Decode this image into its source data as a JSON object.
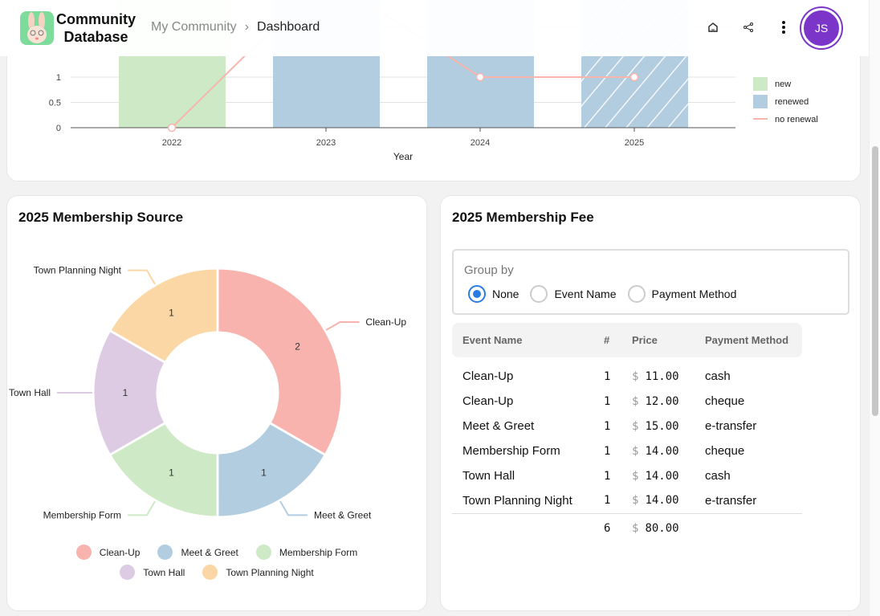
{
  "header": {
    "brand_line1": "Community",
    "brand_line2": "Database",
    "breadcrumb": [
      "My Community",
      "Dashboard"
    ],
    "avatar_initials": "JS",
    "icons": [
      "home-icon",
      "share-icon",
      "more-vertical-icon"
    ]
  },
  "membership_chart": {
    "chart_data": {
      "type": "bar",
      "categories": [
        "2022",
        "2023",
        "2024",
        "2025"
      ],
      "xlabel": "Year",
      "ylabel": "",
      "y_ticks": [
        "0",
        "0.5",
        "1"
      ],
      "series": [
        {
          "name": "new",
          "type": "bar",
          "values": [
            3,
            0,
            0,
            0
          ],
          "color": "#cde9c6"
        },
        {
          "name": "renewed",
          "type": "bar",
          "values": [
            0,
            3,
            3,
            3
          ],
          "color": "#b3cde0",
          "hatched_categories": [
            "2025"
          ]
        },
        {
          "name": "no renewal",
          "type": "line",
          "values": [
            0,
            3,
            1,
            1
          ],
          "color": "#f7b5ad"
        }
      ],
      "legend": "right",
      "grid": true
    }
  },
  "source_card": {
    "title": "2025 Membership Source",
    "chart_data": {
      "type": "pie",
      "donut": true,
      "slices": [
        {
          "label": "Clean-Up",
          "value": 2,
          "color": "#f8b3ae"
        },
        {
          "label": "Meet & Greet",
          "value": 1,
          "color": "#b3cde0"
        },
        {
          "label": "Membership Form",
          "value": 1,
          "color": "#cde9c6"
        },
        {
          "label": "Town Hall",
          "value": 1,
          "color": "#dccbe3"
        },
        {
          "label": "Town Planning Night",
          "value": 1,
          "color": "#fbd7a6"
        }
      ],
      "legend": "bottom"
    }
  },
  "fee_card": {
    "title": "2025 Membership Fee",
    "group_by_label": "Group by",
    "options": [
      {
        "label": "None",
        "selected": true
      },
      {
        "label": "Event Name",
        "selected": false
      },
      {
        "label": "Payment Method",
        "selected": false
      }
    ],
    "columns": [
      "Event Name",
      "#",
      "Price",
      "Payment Method"
    ],
    "rows": [
      {
        "event": "Clean-Up",
        "count": "1",
        "currency": "$",
        "price": "11.00",
        "method": "cash"
      },
      {
        "event": "Clean-Up",
        "count": "1",
        "currency": "$",
        "price": "12.00",
        "method": "cheque"
      },
      {
        "event": "Meet & Greet",
        "count": "1",
        "currency": "$",
        "price": "15.00",
        "method": "e-transfer"
      },
      {
        "event": "Membership Form",
        "count": "1",
        "currency": "$",
        "price": "14.00",
        "method": "cheque"
      },
      {
        "event": "Town Hall",
        "count": "1",
        "currency": "$",
        "price": "14.00",
        "method": "cash"
      },
      {
        "event": "Town Planning Night",
        "count": "1",
        "currency": "$",
        "price": "14.00",
        "method": "e-transfer"
      }
    ],
    "total": {
      "count": "6",
      "currency": "$",
      "price": "80.00"
    }
  }
}
